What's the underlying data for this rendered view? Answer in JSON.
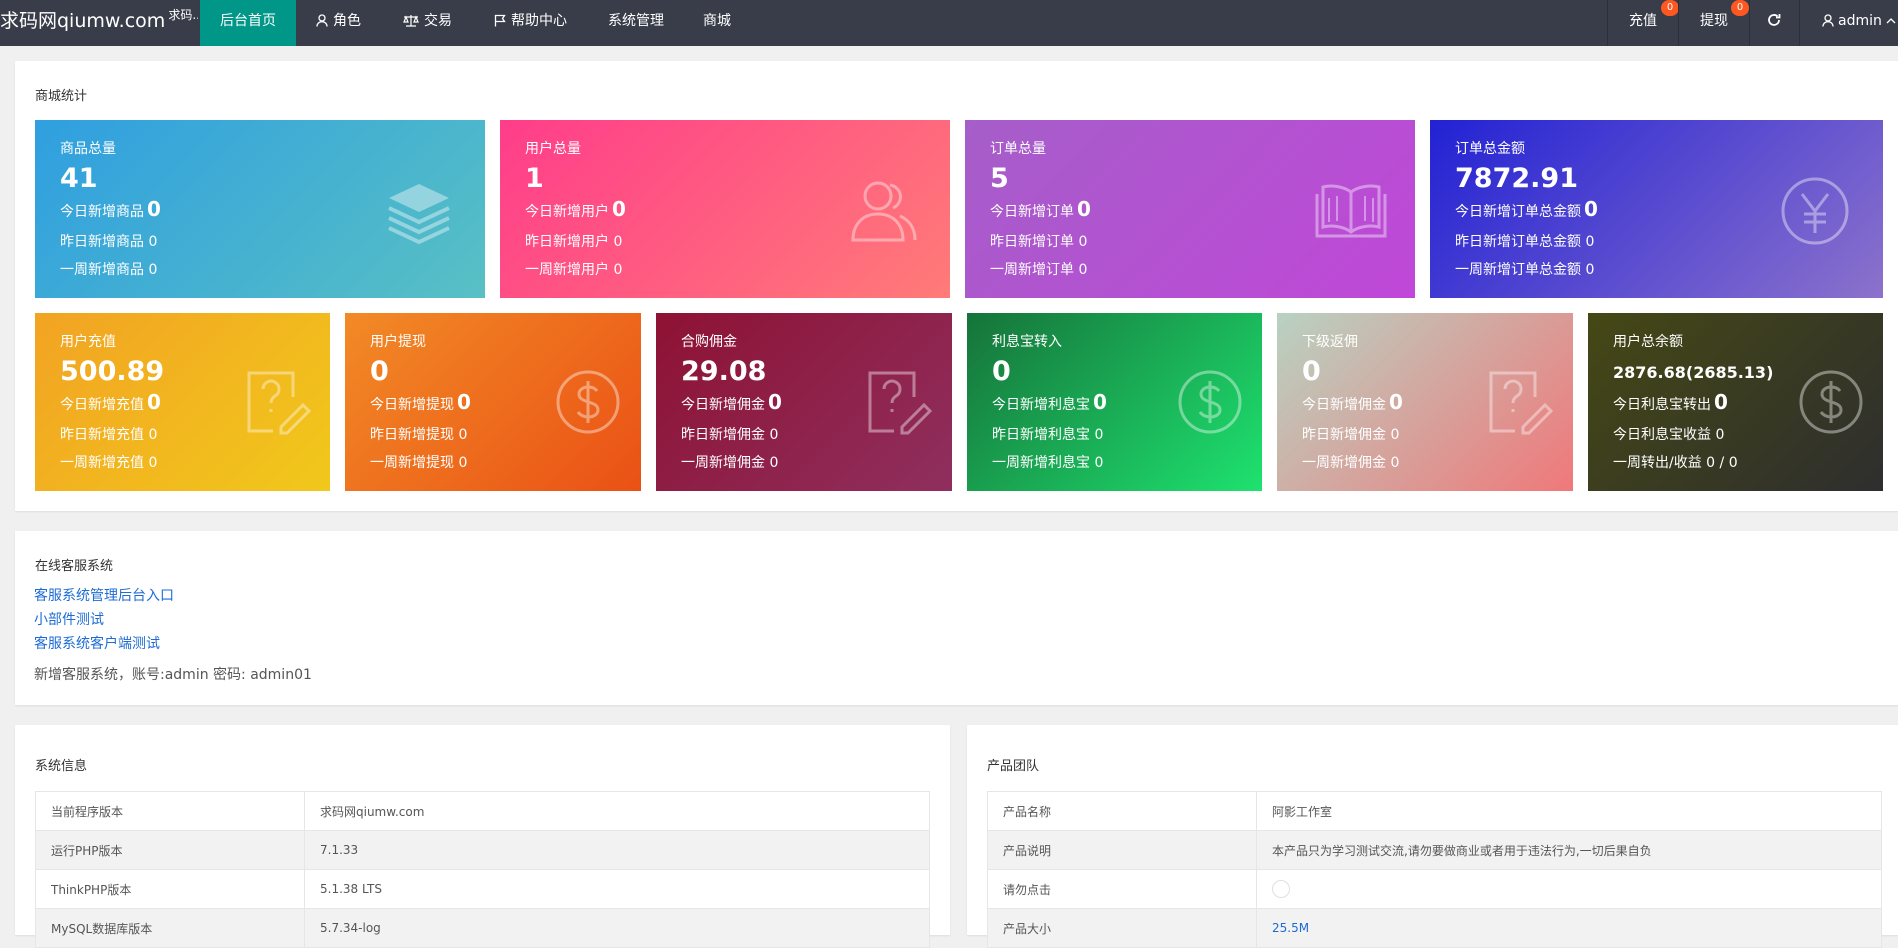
{
  "header": {
    "logo_main": "求码网qiumw.com",
    "logo_sup": "求码...",
    "nav": [
      "后台首页",
      "角色",
      "交易",
      "帮助中心",
      "系统管理",
      "商城"
    ],
    "recharge_label": "充值",
    "recharge_badge": "0",
    "withdraw_label": "提现",
    "withdraw_badge": "0",
    "user_label": "admin"
  },
  "mall": {
    "title": "商城统计",
    "row1": [
      {
        "title": "商品总量",
        "value": "41",
        "today_label": "今日新增商品",
        "today": "0",
        "yesterday": "昨日新增商品  0",
        "week": "一周新增商品  0",
        "icon": "layers-icon"
      },
      {
        "title": "用户总量",
        "value": "1",
        "today_label": "今日新增用户",
        "today": "0",
        "yesterday": "昨日新增用户  0",
        "week": "一周新增用户  0",
        "icon": "users-icon"
      },
      {
        "title": "订单总量",
        "value": "5",
        "today_label": "今日新增订单",
        "today": "0",
        "yesterday": "昨日新增订单  0",
        "week": "一周新增订单  0",
        "icon": "book-icon"
      },
      {
        "title": "订单总金额",
        "value": "7872.91",
        "today_label": "今日新增订单总金额",
        "today": "0",
        "yesterday": "昨日新增订单总金额  0",
        "week": "一周新增订单总金额  0",
        "icon": "yen-icon"
      }
    ],
    "row2": [
      {
        "title": "用户充值",
        "value": "500.89",
        "today_label": "今日新增充值",
        "today": "0",
        "yesterday": "昨日新增充值  0",
        "week": "一周新增充值  0",
        "icon": "question-edit-icon"
      },
      {
        "title": "用户提现",
        "value": "0",
        "today_label": "今日新增提现",
        "today": "0",
        "yesterday": "昨日新增提现  0",
        "week": "一周新增提现  0",
        "icon": "dollar-icon"
      },
      {
        "title": "合购佣金",
        "value": "29.08",
        "today_label": "今日新增佣金",
        "today": "0",
        "yesterday": "昨日新增佣金  0",
        "week": "一周新增佣金  0",
        "icon": "question-edit-icon"
      },
      {
        "title": "利息宝转入",
        "value": "0",
        "today_label": "今日新增利息宝",
        "today": "0",
        "yesterday": "昨日新增利息宝  0",
        "week": "一周新增利息宝  0",
        "icon": "dollar-icon"
      },
      {
        "title": "下级返佣",
        "value": "0",
        "today_label": "今日新增佣金",
        "today": "0",
        "yesterday": "昨日新增佣金  0",
        "week": "一周新增佣金  0",
        "icon": "question-edit-icon"
      },
      {
        "title": "用户总余额",
        "value": "2876.68(2685.13)",
        "today_label": "今日利息宝转出",
        "today": "0",
        "yesterday": "今日利息宝收益  0",
        "week": "一周转出/收益  0 / 0",
        "icon": "dollar-icon"
      }
    ]
  },
  "service": {
    "title": "在线客服系统",
    "links": [
      "客服系统管理后台入口",
      "小部件测试",
      "客服系统客户端测试"
    ],
    "note": "新增客服系统，账号:admin  密码: admin01"
  },
  "sysinfo": {
    "title": "系统信息",
    "rows": [
      [
        "当前程序版本",
        "求码网qiumw.com"
      ],
      [
        "运行PHP版本",
        "7.1.33"
      ],
      [
        "ThinkPHP版本",
        "5.1.38 LTS"
      ],
      [
        "MySQL数据库版本",
        "5.7.34-log"
      ]
    ]
  },
  "team": {
    "title": "产品团队",
    "rows": [
      [
        "产品名称",
        "阿影工作室"
      ],
      [
        "产品说明",
        "本产品只为学习测试交流,请勿要做商业或者用于违法行为,一切后果自负"
      ],
      [
        "请勿点击",
        ""
      ],
      [
        "产品大小",
        "25.5M"
      ]
    ]
  },
  "colors": {
    "topbar": "#393d49",
    "active_nav": "#009688",
    "badge": "#ff5722",
    "link": "#1e6bd6"
  }
}
